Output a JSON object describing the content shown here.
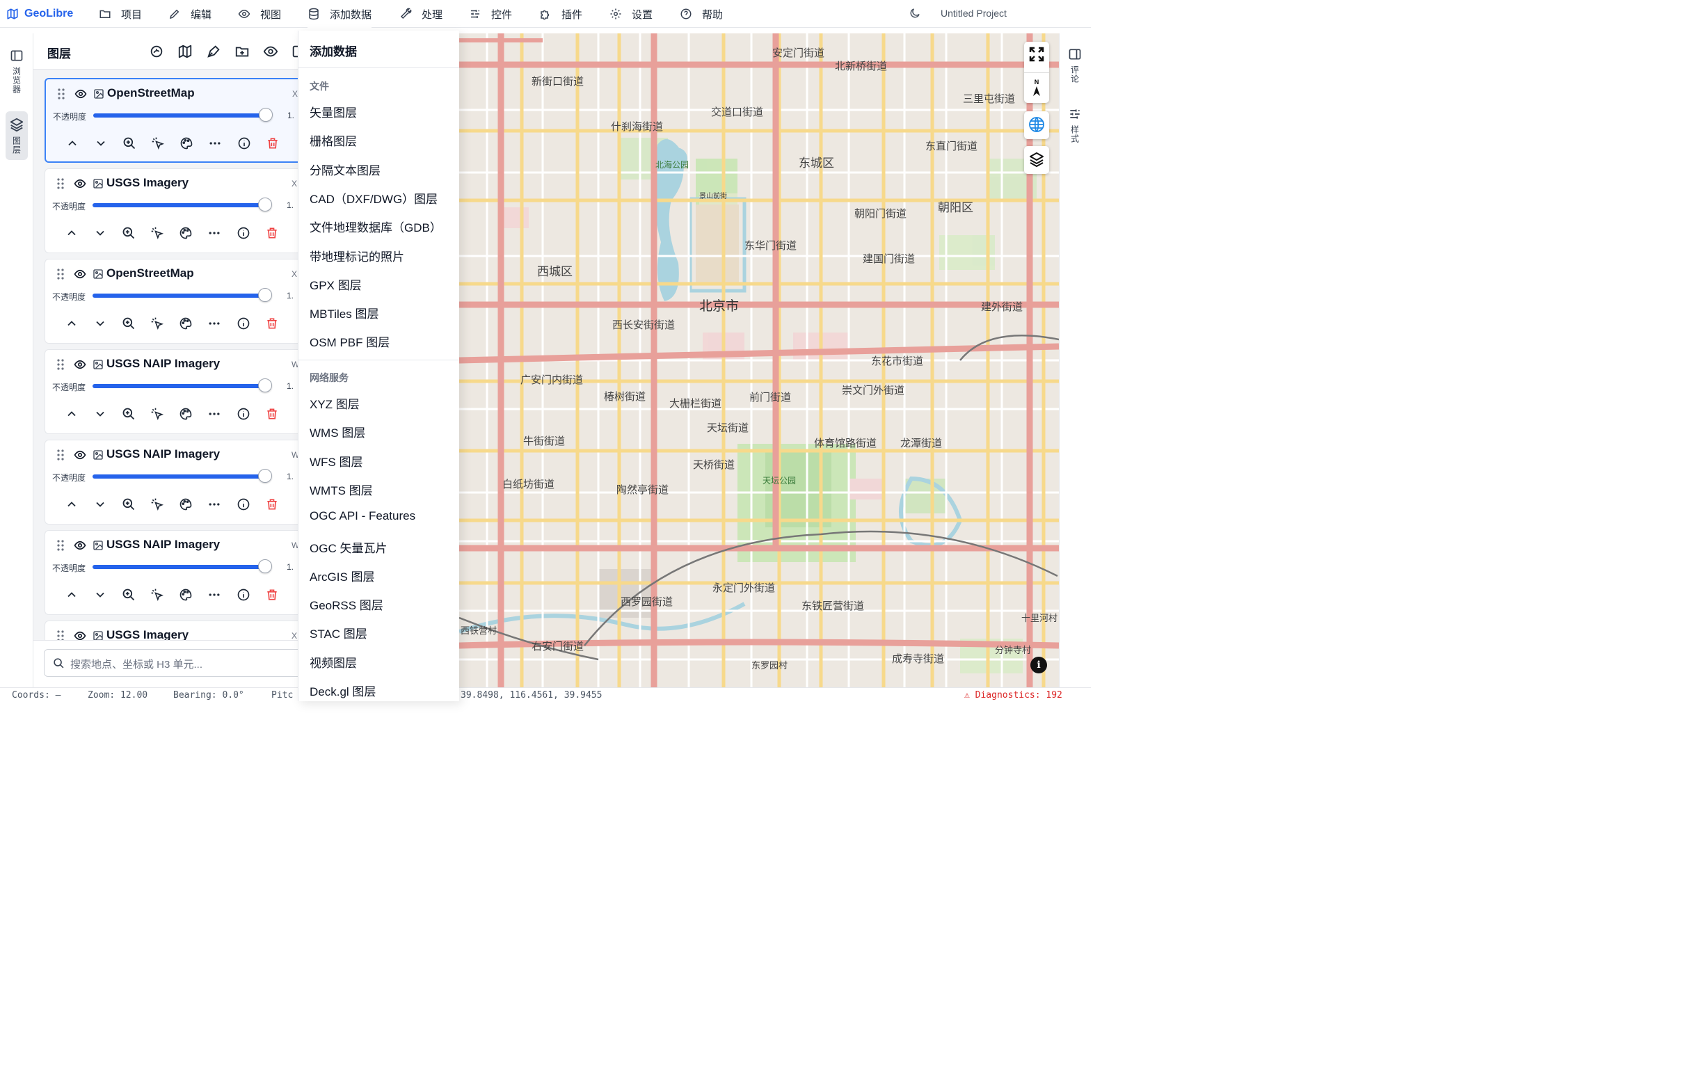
{
  "app": {
    "name": "GeoLibre",
    "project_title": "Untitled Project"
  },
  "menu": [
    {
      "key": "project",
      "label": "项目",
      "icon": "folder-icon"
    },
    {
      "key": "edit",
      "label": "编辑",
      "icon": "pencil-icon"
    },
    {
      "key": "view",
      "label": "视图",
      "icon": "eye-icon"
    },
    {
      "key": "add-data",
      "label": "添加数据",
      "icon": "database-icon"
    },
    {
      "key": "processing",
      "label": "处理",
      "icon": "wrench-icon"
    },
    {
      "key": "controls",
      "label": "控件",
      "icon": "sliders-icon"
    },
    {
      "key": "plugins",
      "label": "插件",
      "icon": "puzzle-icon"
    },
    {
      "key": "settings",
      "label": "设置",
      "icon": "gear-icon"
    },
    {
      "key": "help",
      "label": "帮助",
      "icon": "help-circle-icon"
    }
  ],
  "left_rail": {
    "browser_label": "浏览器",
    "layers_label": "图层"
  },
  "layers_panel": {
    "title": "图层",
    "opacity_label": "不透明度",
    "layers": [
      {
        "name": "OpenStreetMap",
        "badge": "X",
        "opacity": "1.",
        "opacity_fraction": 1.0,
        "selected": true
      },
      {
        "name": "USGS Imagery",
        "badge": "X",
        "opacity": "1.",
        "opacity_fraction": 1.0,
        "selected": false
      },
      {
        "name": "OpenStreetMap",
        "badge": "X",
        "opacity": "1.",
        "opacity_fraction": 1.0,
        "selected": false
      },
      {
        "name": "USGS NAIP Imagery",
        "badge": "WI",
        "opacity": "1.",
        "opacity_fraction": 1.0,
        "selected": false
      },
      {
        "name": "USGS NAIP Imagery",
        "badge": "WI",
        "opacity": "1.",
        "opacity_fraction": 1.0,
        "selected": false
      },
      {
        "name": "USGS NAIP Imagery",
        "badge": "WI",
        "opacity": "1.",
        "opacity_fraction": 1.0,
        "selected": false
      },
      {
        "name": "USGS Imagery",
        "badge": "X",
        "opacity": "",
        "opacity_fraction": 1.0,
        "selected": false
      }
    ],
    "search_placeholder": "搜索地点、坐标或 H3 单元..."
  },
  "add_data_menu": {
    "title": "添加数据",
    "file_section": "文件",
    "file_items": [
      "矢量图层",
      "栅格图层",
      "分隔文本图层",
      "CAD（DXF/DWG）图层",
      "文件地理数据库（GDB）",
      "带地理标记的照片",
      "GPX 图层",
      "MBTiles 图层",
      "OSM PBF 图层"
    ],
    "web_section": "网络服务",
    "web_items": [
      "XYZ 图层",
      "WMS 图层",
      "WFS 图层",
      "WMTS 图层",
      "OGC API - Features",
      "OGC 矢量瓦片",
      "ArcGIS 图层",
      "GeoRSS 图层",
      "STAC 图层",
      "视频图层",
      "Deck.gl 图层"
    ]
  },
  "map": {
    "labels": {
      "city": "北京市",
      "xicheng": "西城区",
      "dongcheng": "东城区",
      "chaoyang": "朝阳区",
      "tiantan_park": "天坛公园",
      "beihai_park": "北海公园",
      "jingshan": "景山前街",
      "xichang": "西长安街街道",
      "dongchang": "东华门街道",
      "jiaodaokou": "交道口街道",
      "shichahai": "什刹海街道",
      "andingmen": "安定门街道",
      "beixinqiao": "北新桥街道",
      "xinjiekou": "新街口街道",
      "sanlitun": "三里屯街道",
      "dongzhimen": "东直门街道",
      "chaoyangmen": "朝阳门街道",
      "jianguomen": "建国门街道",
      "jianwai": "建外街道",
      "donghuashi": "东花市街道",
      "chongwen": "崇文门外街道",
      "qianmen": "前门街道",
      "dashilan": "大栅栏街道",
      "chunshu": "椿树街道",
      "guanganmen": "广安门内街道",
      "niujie": "牛街街道",
      "baizhifang": "白纸坊街道",
      "taoranting": "陶然亭街道",
      "tianqiao": "天桥街道",
      "tiyuguan": "体育馆路街道",
      "longtan": "龙潭街道",
      "yongdingmen": "永定门外街道",
      "xiluoyuan": "西罗园街道",
      "dongtiejiang": "东铁匠营街道",
      "youanmen": "右安门街道",
      "chengshousi": "成寿寺街道",
      "xitieying": "西铁营村",
      "dongluoyuan": "东罗园村",
      "shilihe": "十里河村",
      "fenzhongsi": "分钟寺村",
      "tiantan": "天坛街道"
    }
  },
  "right_rail": {
    "comments_label": "评论",
    "style_label": "样式"
  },
  "status": {
    "coords": "Coords: —",
    "zoom": "Zoom: 12.00",
    "bearing": "Bearing: 0.0°",
    "pitch": "Pitc",
    "extent": "39.8498, 116.4561, 39.9455",
    "diagnostics": "⚠ Diagnostics: 192"
  },
  "colors": {
    "accent": "#2563eb",
    "danger": "#ef4444",
    "map_bg": "#ede8e1",
    "road_major": "#e8a09a",
    "road_secondary": "#f7d98b",
    "park": "#c8e6b4",
    "water": "#aad3df"
  }
}
